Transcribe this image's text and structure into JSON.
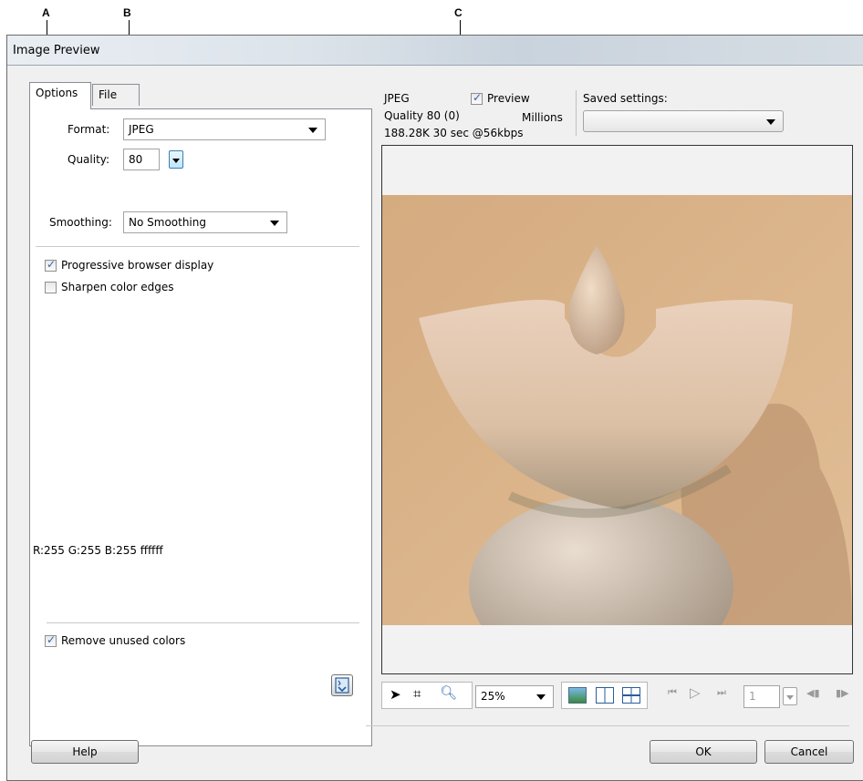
{
  "callouts": {
    "a": "A",
    "b": "B",
    "c": "C"
  },
  "window": {
    "title": "Image Preview"
  },
  "tabs": {
    "options": "Options",
    "file": "File"
  },
  "options": {
    "format_label": "Format:",
    "format_value": "JPEG",
    "quality_label": "Quality:",
    "quality_value": "80",
    "smoothing_label": "Smoothing:",
    "smoothing_value": "No Smoothing",
    "progressive_label": "Progressive browser display",
    "progressive_checked": true,
    "sharpen_label": "Sharpen color edges",
    "sharpen_checked": false,
    "color_readout": "R:255 G:255 B:255 ffffff",
    "remove_unused_label": "Remove unused colors",
    "remove_unused_checked": true
  },
  "preview_info": {
    "format": "JPEG",
    "preview_label": "Preview",
    "preview_checked": true,
    "quality": "Quality 80 (0)",
    "colors": "Millions",
    "size_time": "188.28K  30 sec @56kbps",
    "saved_settings_label": "Saved settings:",
    "saved_settings_value": ""
  },
  "toolbar": {
    "zoom_value": "25%",
    "frame_value": "1",
    "icons": [
      "pointer-icon",
      "crop-icon",
      "zoom-icon",
      "single-view-icon",
      "two-up-icon",
      "four-up-icon",
      "first-frame-icon",
      "play-icon",
      "last-frame-icon",
      "prev-frame-icon",
      "next-frame-icon"
    ]
  },
  "buttons": {
    "help": "Help",
    "ok": "OK",
    "cancel": "Cancel"
  },
  "colors": {
    "photo_bg": "#d9b48b",
    "accent": "#3465a4",
    "dialog_bg": "#f0f0f0"
  }
}
